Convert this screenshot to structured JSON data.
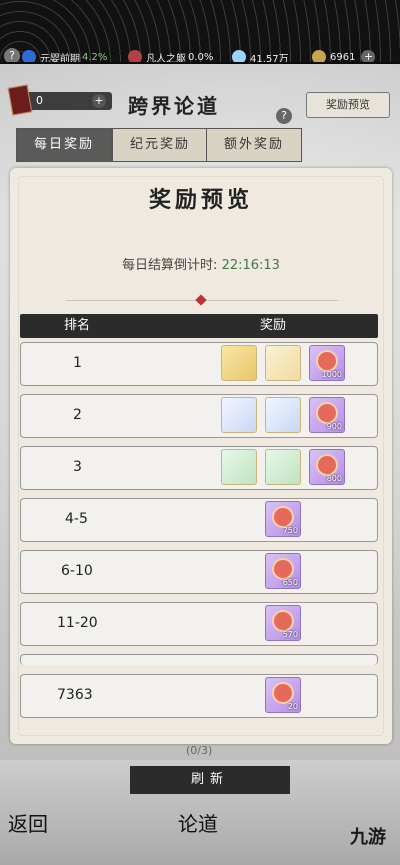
{
  "top": {
    "level_label": "元婴前期",
    "level_percent": "4.2%",
    "body_label": "凡人之躯",
    "body_percent": "0.0%",
    "spirit_stones": "41.57万",
    "gold": "6961"
  },
  "header": {
    "counter_value": "0",
    "title": "跨界论道",
    "preview_button": "奖励预览"
  },
  "tabs": [
    "每日奖励",
    "纪元奖励",
    "额外奖励"
  ],
  "panel": {
    "title": "奖励预览",
    "countdown_label": "每日结算倒计时:",
    "countdown_time": "22:16:13",
    "col_rank": "排名",
    "col_reward": "奖励",
    "rows": [
      {
        "rank": "1",
        "medal": "1000"
      },
      {
        "rank": "2",
        "medal": "900"
      },
      {
        "rank": "3",
        "medal": "800"
      },
      {
        "rank": "4-5",
        "medal": "750"
      },
      {
        "rank": "6-10",
        "medal": "650"
      },
      {
        "rank": "11-20",
        "medal": "570"
      },
      {
        "rank": "7363",
        "medal": "20"
      }
    ]
  },
  "bottom": {
    "fraction": "(0/3)",
    "refresh": "刷新",
    "back": "返回",
    "dao": "论道"
  },
  "watermark": "九游"
}
